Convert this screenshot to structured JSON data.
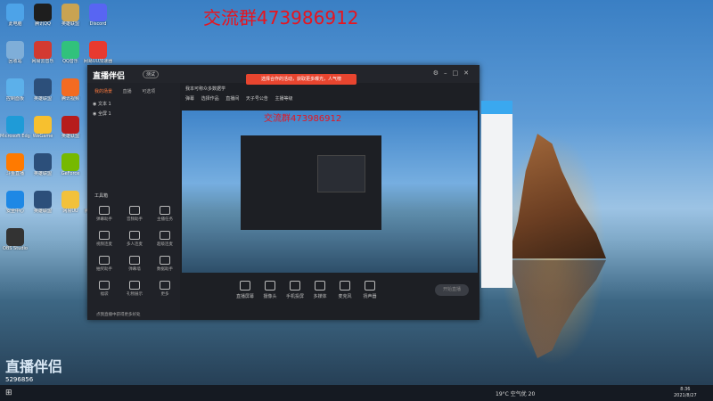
{
  "watermark": "交流群473986912",
  "desktop_icons": [
    {
      "label": "此电脑",
      "color": "#4da3e8"
    },
    {
      "label": "腾讯QQ",
      "color": "#1e1e1e"
    },
    {
      "label": "英雄联盟",
      "color": "#c9a352"
    },
    {
      "label": "Discord",
      "color": "#5865f2"
    },
    {
      "label": "回收站",
      "color": "#7faed8"
    },
    {
      "label": "网易云音乐",
      "color": "#d33a31"
    },
    {
      "label": "QQ音乐",
      "color": "#31c27c"
    },
    {
      "label": "网易UU加速器",
      "color": "#e83a2f"
    },
    {
      "label": "控制面板",
      "color": "#5cb0ea"
    },
    {
      "label": "英雄联盟",
      "color": "#2c4f7a"
    },
    {
      "label": "腾讯视频",
      "color": "#f36b21"
    },
    {
      "label": "Steam",
      "color": "#1b2838"
    },
    {
      "label": "Microsoft Edge",
      "color": "#1f9bd7"
    },
    {
      "label": "WeGame",
      "color": "#f7c02f"
    },
    {
      "label": "英雄联盟",
      "color": "#b71c1c"
    },
    {
      "label": "直播伴侣",
      "color": "#f24a3d"
    },
    {
      "label": "斗鱼直播",
      "color": "#ff7a00"
    },
    {
      "label": "英雄联盟",
      "color": "#2c4f7a"
    },
    {
      "label": "GeForce",
      "color": "#76b900"
    },
    {
      "label": "英雄联盟",
      "color": "#c9a352"
    },
    {
      "label": "安全中心",
      "color": "#1e88e5"
    },
    {
      "label": "英雄联盟",
      "color": "#2c4f7a"
    },
    {
      "label": "网易UU",
      "color": "#f2c13b"
    },
    {
      "label": "腾讯电脑管家",
      "color": "#1e88e5"
    },
    {
      "label": "OBS Studio",
      "color": "#333"
    }
  ],
  "window": {
    "logo": "直播伴侣",
    "version": "测试",
    "promo": "选择合作的活动，获取更多曝光，人气榜",
    "tabs": [
      "我的场景",
      "直播",
      "可选项"
    ],
    "scenes": [
      "文本 1",
      "全屏 1"
    ],
    "tools_title": "工具箱",
    "tools": [
      "弹幕助手",
      "音频助手",
      "主播任务",
      "视频连麦",
      "多人连麦",
      "超级连麦",
      "抽奖助手",
      "弹幕墙",
      "数据助手",
      "福袋",
      "礼物展示",
      "更多"
    ],
    "bottom_tip": "点我直播中获得更多好处",
    "preview_title": "我本可称众多数据学",
    "preview_meta": [
      "弹幕",
      "选择作品",
      "直播间",
      "天子号公告",
      "主播等级"
    ],
    "preview_watermark": "交流群473986912",
    "controls": [
      "直播屏幕",
      "摄像头",
      "手机投屏",
      "多媒体",
      "麦克风",
      "扬声器"
    ],
    "start_button": "开始直播"
  },
  "taskbar": {
    "tray": "19°C 空气优 20",
    "time": "8:36",
    "date": "2021/8/27"
  },
  "overlay_user": {
    "name": "直播伴侣",
    "id": "5296856"
  }
}
